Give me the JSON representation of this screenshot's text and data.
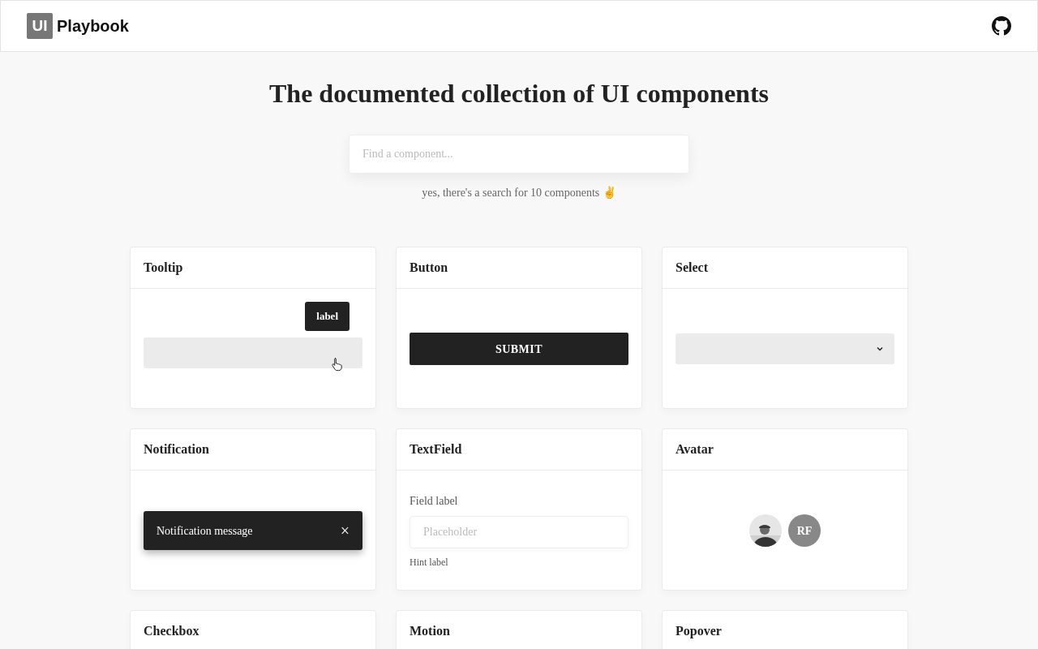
{
  "header": {
    "logo_mark": "UI",
    "logo_text": "Playbook"
  },
  "hero": {
    "title": "The documented collection of UI components",
    "search": {
      "placeholder": "Find a component..."
    },
    "hint": "yes, there's a search for 10 components ✌️"
  },
  "cards": [
    {
      "title": "Tooltip",
      "kind": "tooltip",
      "tooltip": "label"
    },
    {
      "title": "Button",
      "kind": "button",
      "button": "SUBMIT"
    },
    {
      "title": "Select",
      "kind": "select"
    },
    {
      "title": "Notification",
      "kind": "notification",
      "message": "Notification message",
      "close": "×"
    },
    {
      "title": "TextField",
      "kind": "textfield",
      "label": "Field label",
      "placeholder": "Placeholder",
      "hint": "Hint label"
    },
    {
      "title": "Avatar",
      "kind": "avatar",
      "initials": "RF"
    },
    {
      "title": "Checkbox"
    },
    {
      "title": "Motion"
    },
    {
      "title": "Popover"
    }
  ]
}
